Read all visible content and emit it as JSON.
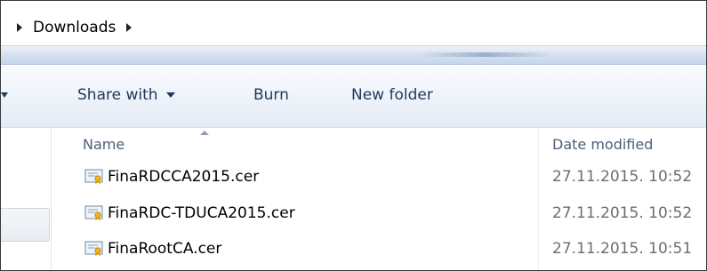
{
  "address_bar": {
    "folder": "Downloads"
  },
  "toolbar": {
    "share_with": "Share with",
    "burn": "Burn",
    "new_folder": "New folder"
  },
  "columns": {
    "name": "Name",
    "date_modified": "Date modified"
  },
  "files": [
    {
      "name": "FinaRDCCA2015.cer",
      "date": "27.11.2015. 10:52",
      "icon": "certificate-icon"
    },
    {
      "name": "FinaRDC-TDUCA2015.cer",
      "date": "27.11.2015. 10:52",
      "icon": "certificate-icon"
    },
    {
      "name": "FinaRootCA.cer",
      "date": "27.11.2015. 10:51",
      "icon": "certificate-icon"
    }
  ],
  "colors": {
    "toolbar_text": "#1e395b",
    "header_text": "#4c607a",
    "date_text": "#6d6d6d"
  }
}
